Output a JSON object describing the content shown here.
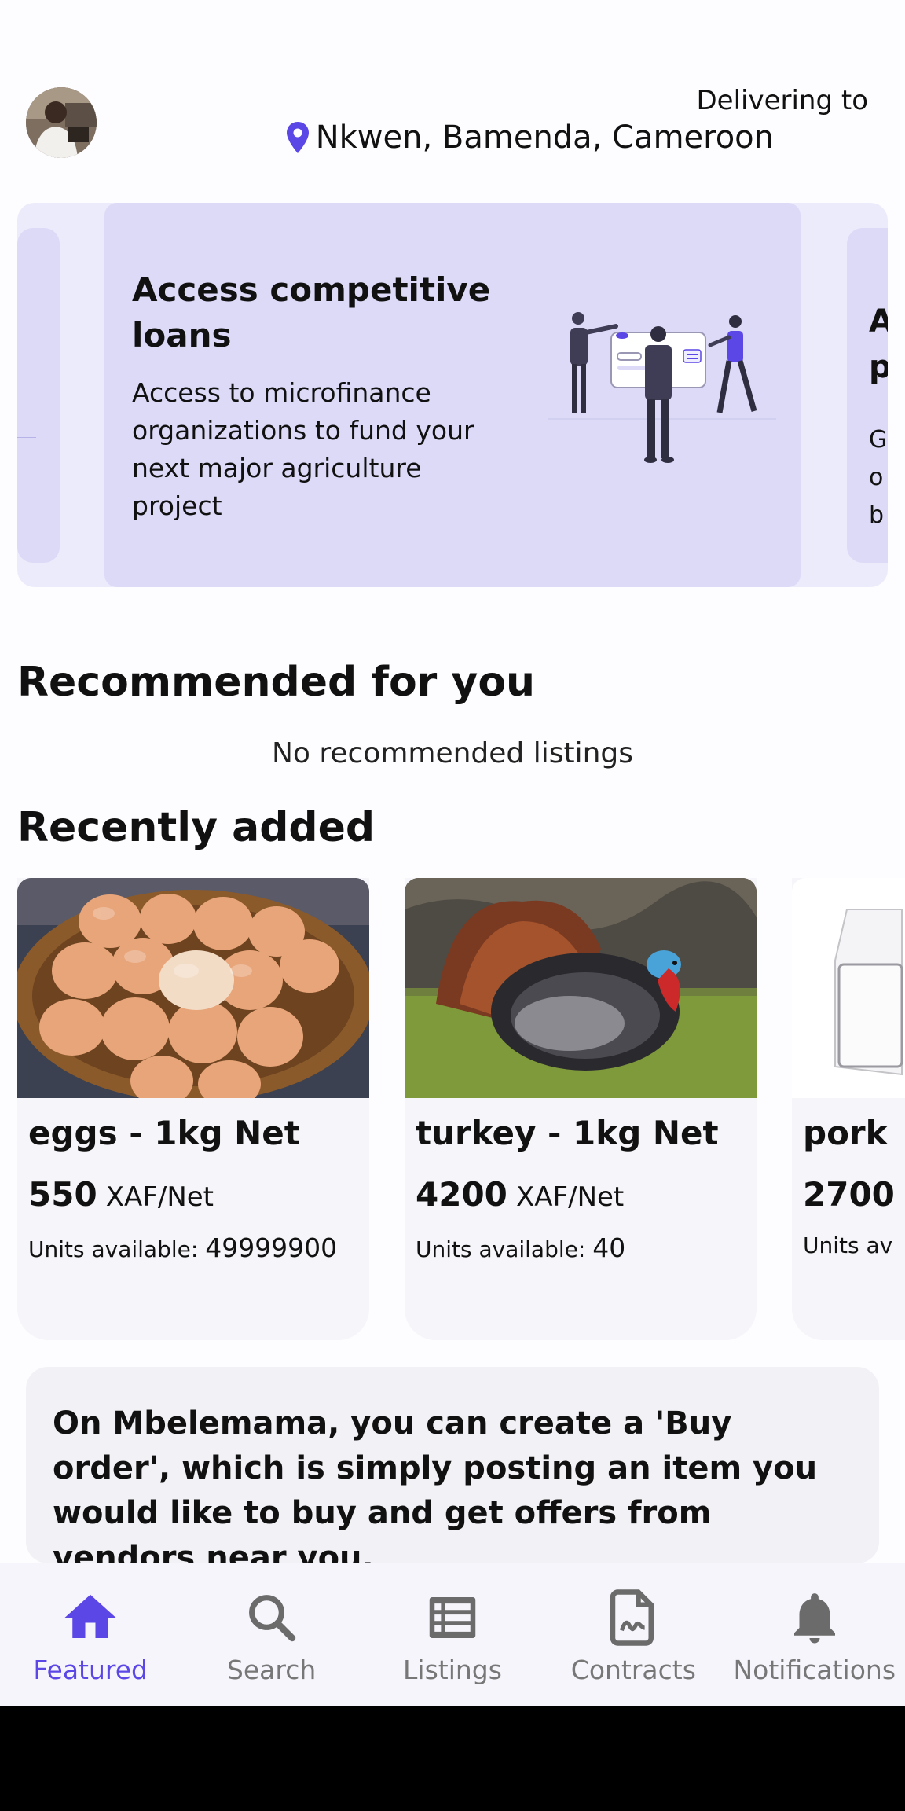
{
  "header": {
    "delivering_label": "Delivering to",
    "location": "Nkwen, Bamenda, Cameroon"
  },
  "carousel": {
    "main": {
      "title": "Access competitive loans",
      "description": "Access to microfinance organizations to fund your next major agriculture project"
    },
    "next_peek": {
      "title_fragment": "A\np",
      "desc_fragment": "G\no\nb"
    }
  },
  "recommended": {
    "title": "Recommended for you",
    "empty_message": "No recommended listings"
  },
  "recent": {
    "title": "Recently added",
    "items": [
      {
        "name": "eggs - 1kg Net",
        "price": "550",
        "unit": "XAF/Net",
        "units_label": "Units available: ",
        "units": "49999900"
      },
      {
        "name": "turkey - 1kg Net",
        "price": "4200",
        "unit": "XAF/Net",
        "units_label": "Units available: ",
        "units": "40"
      },
      {
        "name": "pork",
        "price": "2700",
        "unit": "",
        "units_label": "Units av",
        "units": ""
      }
    ]
  },
  "info_banner": {
    "text": "On Mbelemama, you can create a 'Buy order', which is simply posting an item you would like to buy and get offers from vendors near you."
  },
  "nav": {
    "items": [
      {
        "label": "Featured",
        "icon": "home-icon",
        "active": true
      },
      {
        "label": "Search",
        "icon": "search-icon",
        "active": false
      },
      {
        "label": "Listings",
        "icon": "list-icon",
        "active": false
      },
      {
        "label": "Contracts",
        "icon": "contract-icon",
        "active": false
      },
      {
        "label": "Notifications",
        "icon": "bell-icon",
        "active": false
      }
    ]
  },
  "colors": {
    "accent": "#5b47e6",
    "carousel_bg": "#ecebfb",
    "slide_bg": "#dcdaf7",
    "inactive_nav": "#777777"
  }
}
